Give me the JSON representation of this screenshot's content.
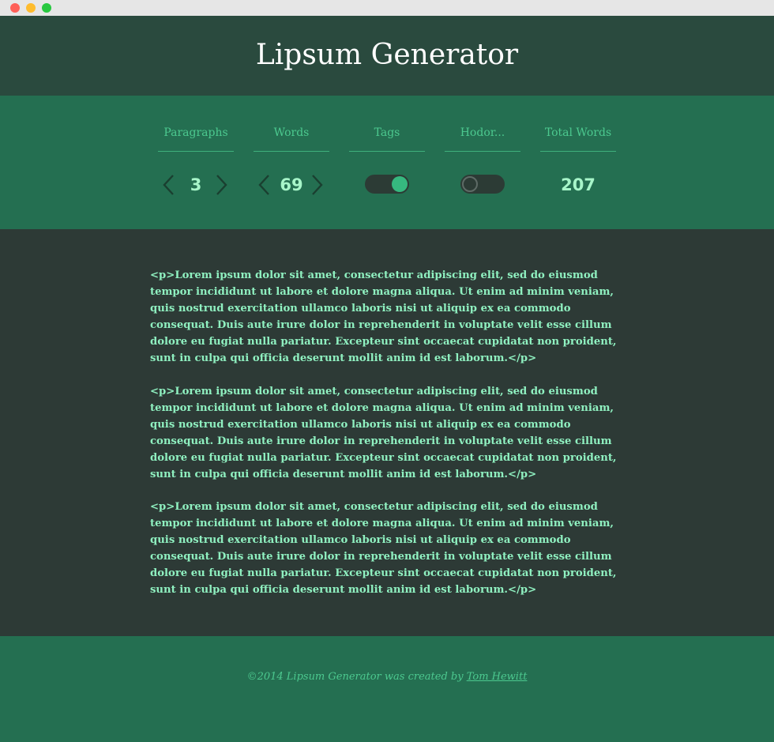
{
  "window": {
    "controls": [
      "close",
      "minimize",
      "maximize"
    ]
  },
  "header": {
    "title": "Lipsum Generator"
  },
  "controls": {
    "paragraphs": {
      "label": "Paragraphs",
      "value": "3"
    },
    "words": {
      "label": "Words",
      "value": "69"
    },
    "tags": {
      "label": "Tags",
      "enabled": true
    },
    "hodor": {
      "label": "Hodor...",
      "enabled": false
    },
    "total": {
      "label": "Total Words",
      "value": "207"
    }
  },
  "content": {
    "paragraphs": [
      "<p>Lorem ipsum dolor sit amet, consectetur adipiscing elit, sed do eiusmod tempor incididunt ut labore et dolore magna aliqua. Ut enim ad minim veniam, quis nostrud exercitation ullamco laboris nisi ut aliquip ex ea commodo consequat. Duis aute irure dolor in reprehenderit in voluptate velit esse cillum dolore eu fugiat nulla pariatur. Excepteur sint occaecat cupidatat non proident, sunt in culpa qui officia deserunt mollit anim id est laborum.</p>",
      "<p>Lorem ipsum dolor sit amet, consectetur adipiscing elit, sed do eiusmod tempor incididunt ut labore et dolore magna aliqua. Ut enim ad minim veniam, quis nostrud exercitation ullamco laboris nisi ut aliquip ex ea commodo consequat. Duis aute irure dolor in reprehenderit in voluptate velit esse cillum dolore eu fugiat nulla pariatur. Excepteur sint occaecat cupidatat non proident, sunt in culpa qui officia deserunt mollit anim id est laborum.</p>",
      "<p>Lorem ipsum dolor sit amet, consectetur adipiscing elit, sed do eiusmod tempor incididunt ut labore et dolore magna aliqua. Ut enim ad minim veniam, quis nostrud exercitation ullamco laboris nisi ut aliquip ex ea commodo consequat. Duis aute irure dolor in reprehenderit in voluptate velit esse cillum dolore eu fugiat nulla pariatur. Excepteur sint occaecat cupidatat non proident, sunt in culpa qui officia deserunt mollit anim id est laborum.</p>"
    ]
  },
  "footer": {
    "text": "©2014 Lipsum Generator was created by ",
    "author": "Tom Hewitt"
  },
  "colors": {
    "header_bg": "#2a4a3e",
    "band_bg": "#246f51",
    "content_bg": "#2d3a36",
    "text_accent": "#8ff0c0",
    "label_accent": "#4cc98f"
  }
}
